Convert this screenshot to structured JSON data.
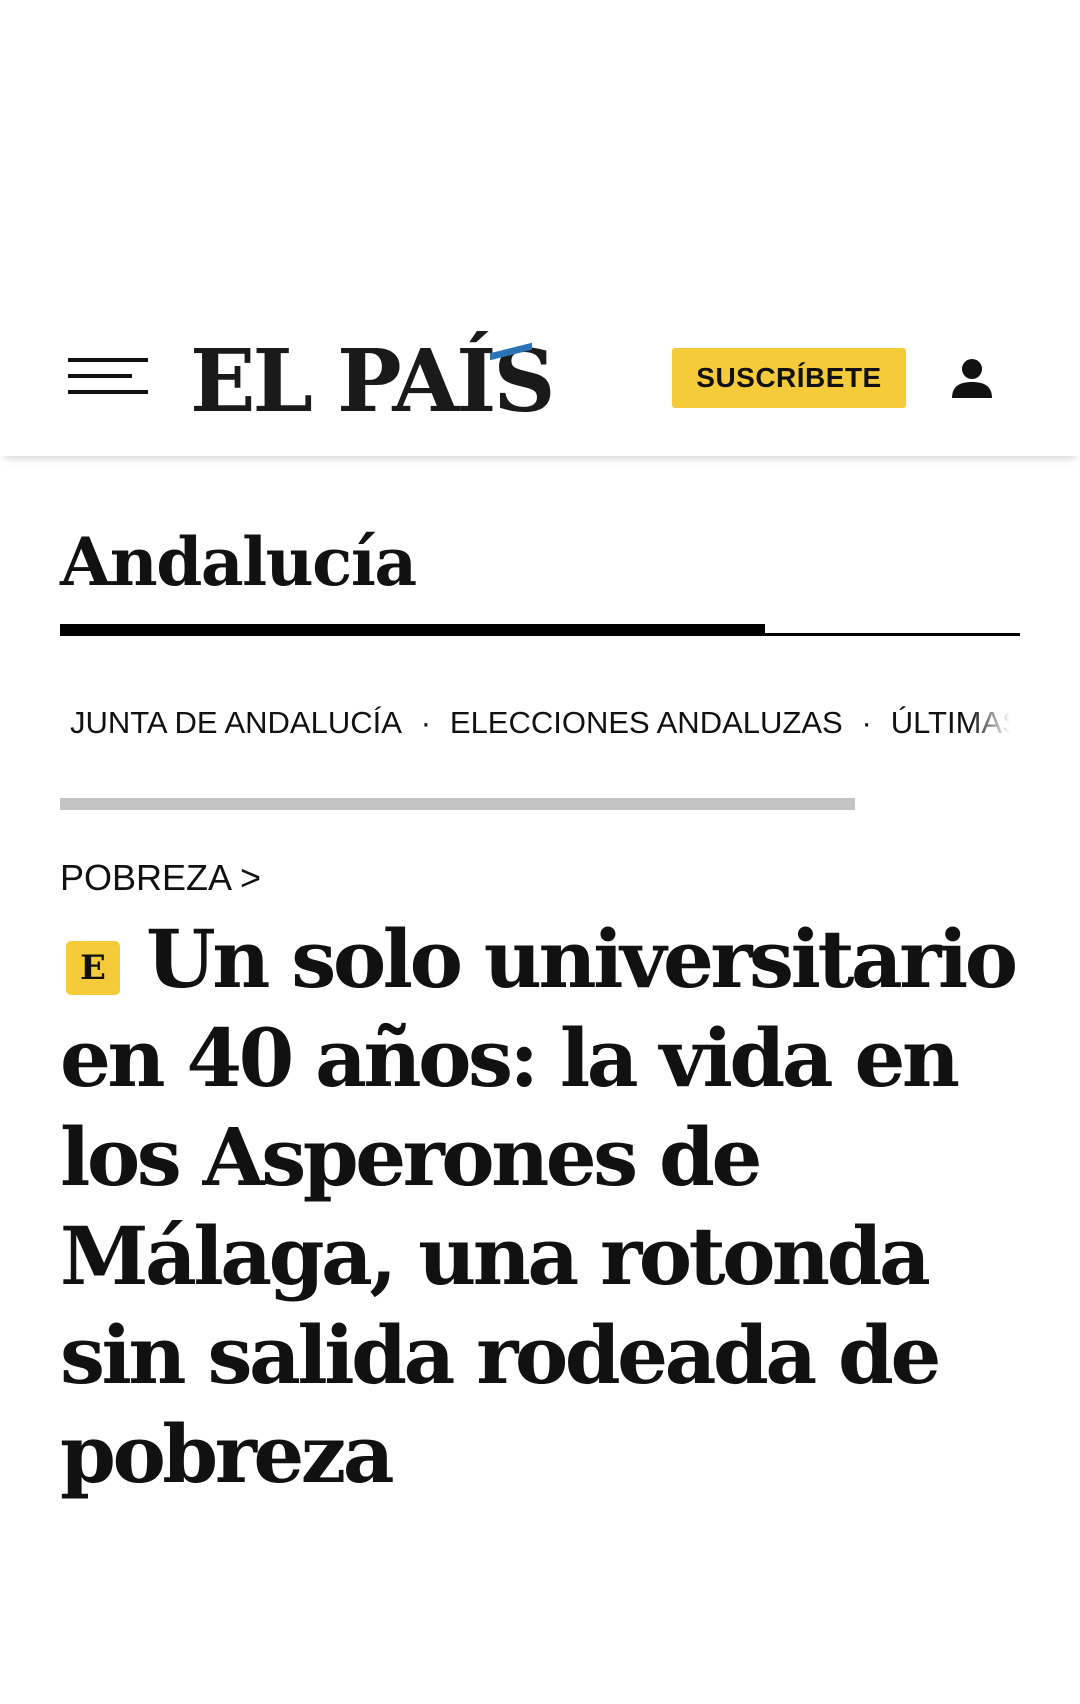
{
  "header": {
    "logo_text": "EL PAÍS",
    "subscribe_label": "SUSCRÍBETE",
    "menu_icon": "hamburger-menu-icon",
    "user_icon": "user-icon"
  },
  "section": {
    "title": "Andalucía"
  },
  "subnav": {
    "items": [
      "JUNTA DE ANDALUCÍA",
      "ELECCIONES ANDALUZAS",
      "ÚLTIMAS"
    ],
    "separator": "·"
  },
  "article": {
    "kicker": "POBREZA >",
    "premium_badge_letter": "E",
    "headline": "Un solo universitario en 40 años: la vida en los Asperones de Málaga, una rotonda sin salida rodeada de pobreza"
  },
  "colors": {
    "accent_yellow": "#f6cb39",
    "logo_accent_blue": "#2a73b4",
    "text": "#111111",
    "scroll_track": "#c4c4c4"
  }
}
